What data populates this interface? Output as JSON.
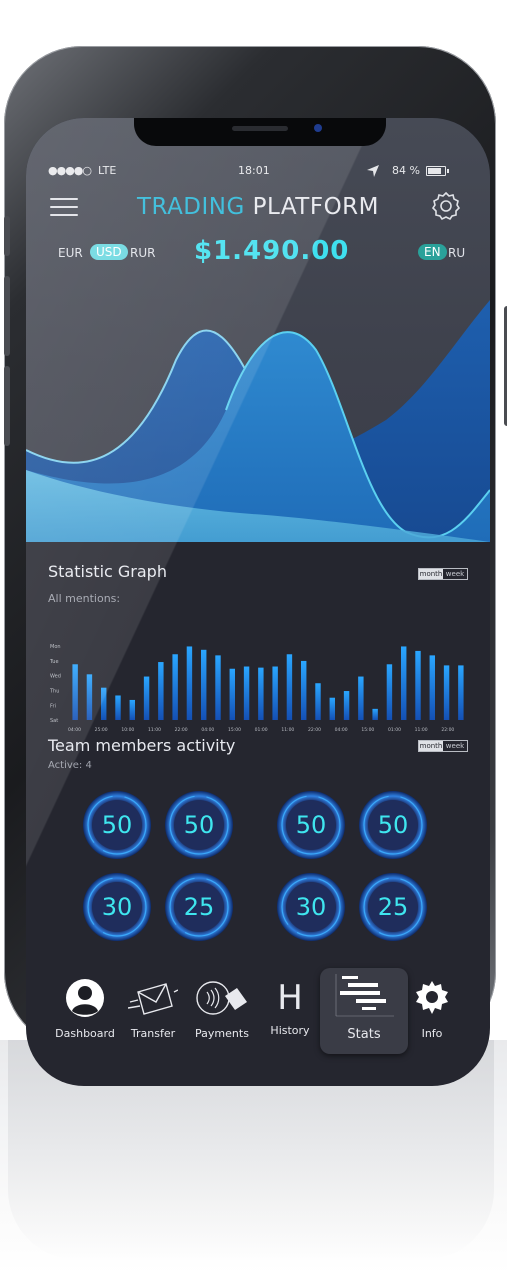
{
  "status": {
    "signal": "●●●●○",
    "carrier": "LTE",
    "time": "18:01",
    "location_icon": "location-arrow-icon",
    "battery": "84 %"
  },
  "header": {
    "title_part1": "TRADING",
    "title_part2": " PLATFORM",
    "menu_icon": "hamburger-menu-icon",
    "settings_icon": "gear-outline-icon"
  },
  "currency": {
    "options": [
      "EUR",
      "USD",
      "RUR"
    ],
    "selected": "USD",
    "balance": "$1.490.00"
  },
  "language": {
    "options": [
      "EN",
      "RU"
    ],
    "selected": "EN"
  },
  "colors": {
    "accent": "#3fe0ef",
    "title_accent": "#28b7d8",
    "background": "#25262f",
    "area_light": "#5bb4e0",
    "area_mid": "#2b7fc6",
    "area_dark": "#1a4f9f"
  },
  "statistic": {
    "title": "Statistic Graph",
    "subtitle": "All mentions:",
    "toggle_on": "month",
    "toggle_off": "week"
  },
  "chart_data": {
    "type": "bar",
    "y_categories": [
      "Mon",
      "Tue",
      "Wed",
      "Thu",
      "Fri",
      "Sat"
    ],
    "x_labels": [
      "04:00",
      "25:00",
      "10:00",
      "11:00",
      "22:00",
      "04:00",
      "15:00",
      "01:00",
      "11:00",
      "22:00",
      "04:00",
      "15:00",
      "01:00",
      "11:00",
      "22:00"
    ],
    "values": [
      5.0,
      4.1,
      2.9,
      2.2,
      1.8,
      3.9,
      5.2,
      5.9,
      6.6,
      6.3,
      5.8,
      4.6,
      4.8,
      4.7,
      4.8,
      5.9,
      5.3,
      3.3,
      2.0,
      2.6,
      3.9,
      1.0,
      5.0,
      6.6,
      6.2,
      5.8,
      4.9,
      4.9
    ]
  },
  "team": {
    "title": "Team members activity",
    "subtitle": "Active: 4",
    "toggle_on": "month",
    "toggle_off": "week",
    "values": [
      50,
      50,
      50,
      50,
      30,
      25,
      30,
      25
    ]
  },
  "nav": [
    {
      "label": "Dashboard",
      "icon": "user-avatar-icon"
    },
    {
      "label": "Transfer",
      "icon": "envelope-icon"
    },
    {
      "label": "Payments",
      "icon": "contactless-card-icon"
    },
    {
      "label": "History",
      "icon": "letter-h-icon"
    },
    {
      "label": "Stats",
      "icon": "gantt-chart-icon"
    },
    {
      "label": "Info",
      "icon": "gear-icon"
    }
  ],
  "nav_history_glyph": "H"
}
